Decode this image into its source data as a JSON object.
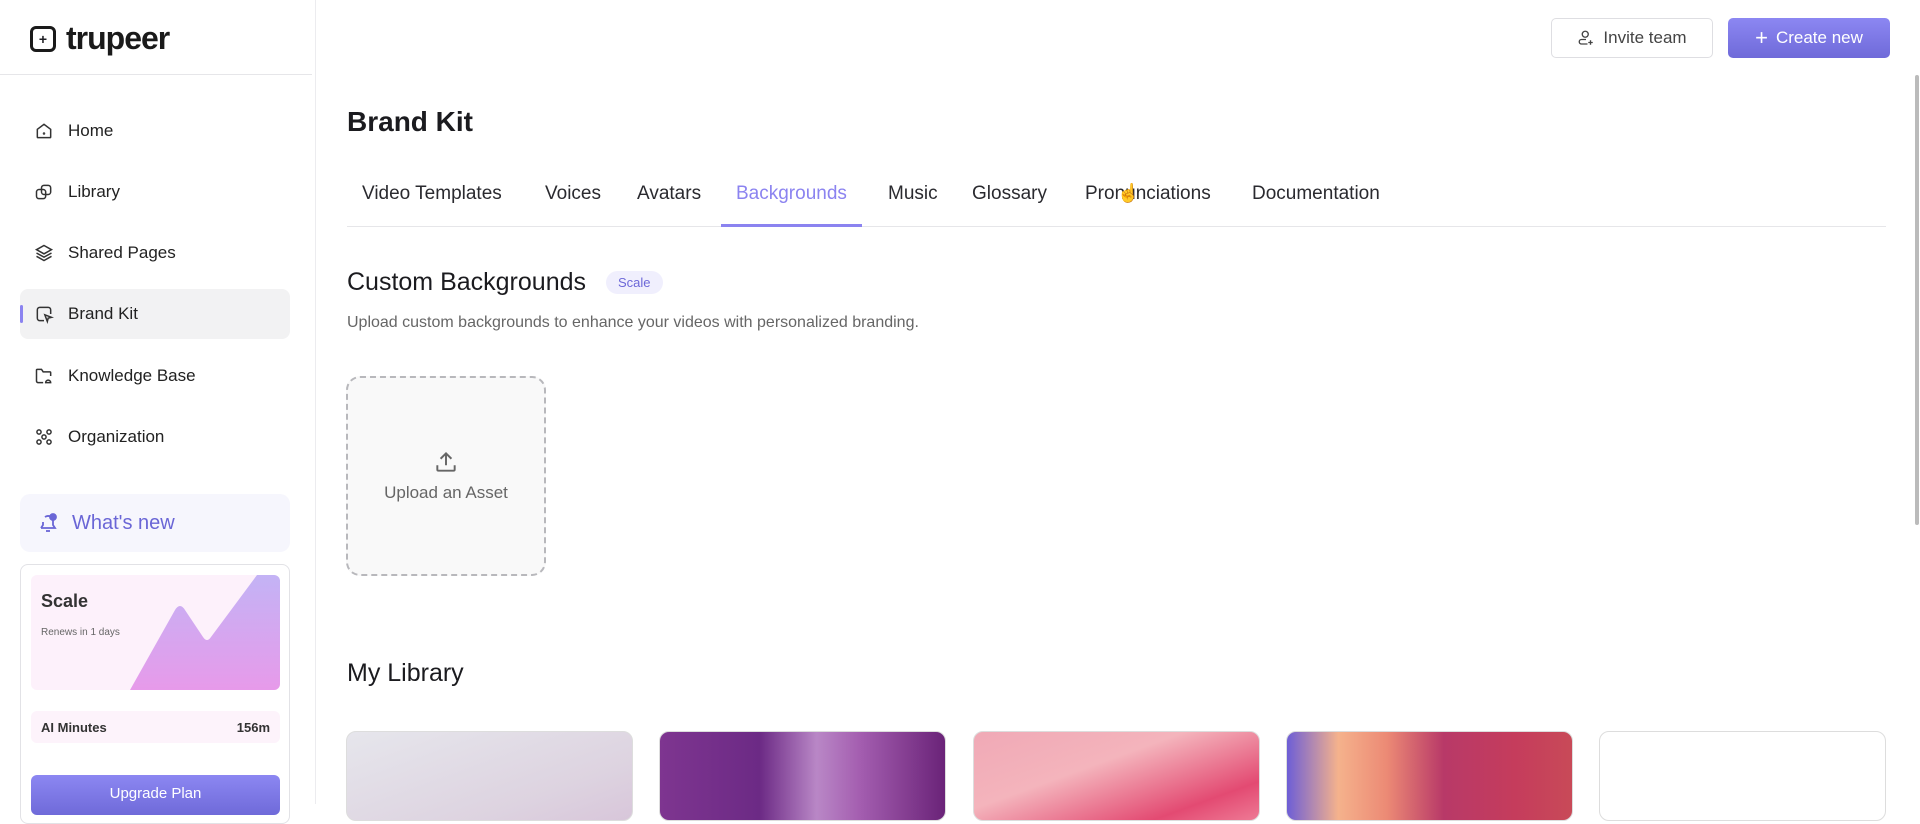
{
  "brand": {
    "name": "trupeer"
  },
  "sidebar": {
    "items": [
      {
        "label": "Home",
        "icon": "home-icon"
      },
      {
        "label": "Library",
        "icon": "library-icon"
      },
      {
        "label": "Shared Pages",
        "icon": "layers-icon"
      },
      {
        "label": "Brand Kit",
        "icon": "brand-kit-icon",
        "active": true
      },
      {
        "label": "Knowledge Base",
        "icon": "folder-icon"
      },
      {
        "label": "Organization",
        "icon": "organization-icon"
      }
    ],
    "whats_new": "What's new",
    "plan": {
      "name": "Scale",
      "renews": "Renews in 1 days",
      "minutes_label": "AI Minutes",
      "minutes_value": "156m",
      "upgrade": "Upgrade Plan"
    }
  },
  "header": {
    "invite": "Invite team",
    "create": "Create new"
  },
  "main": {
    "title": "Brand Kit",
    "tabs": [
      "Video Templates",
      "Voices",
      "Avatars",
      "Backgrounds",
      "Music",
      "Glossary",
      "Pronunciations",
      "Documentation"
    ],
    "active_tab": "Backgrounds",
    "custom": {
      "title": "Custom Backgrounds",
      "badge": "Scale",
      "description": "Upload custom backgrounds to enhance your videos with personalized branding.",
      "upload": "Upload an Asset"
    },
    "library": {
      "title": "My Library"
    }
  },
  "colors": {
    "accent": "#8b83f0"
  }
}
